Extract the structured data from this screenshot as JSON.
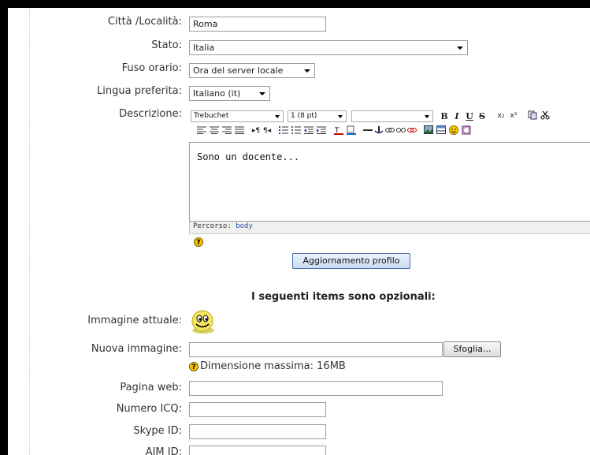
{
  "form": {
    "city_label": "Città /Località:",
    "city_value": "Roma",
    "country_label": "Stato:",
    "country_value": "Italia",
    "timezone_label": "Fuso orario:",
    "timezone_value": "Ora del server locale",
    "language_label": "Lingua preferita:",
    "language_value": "Italiano (it)",
    "description_label": "Descrizione:",
    "editor": {
      "font_value": "Trebuchet",
      "size_value": "1 (8 pt)",
      "format_value": "",
      "content": "Sono un docente...",
      "path_label": "Percorso:",
      "path_value": "body"
    },
    "update_button": "Aggiornamento profilo",
    "optional_heading": "I seguenti items sono opzionali:",
    "current_image_label": "Immagine attuale:",
    "new_image_label": "Nuova immagine:",
    "browse_button": "Sfoglia...",
    "max_size_text": "Dimensione massima: 16MB",
    "webpage_label": "Pagina web:",
    "icq_label": "Numero ICQ:",
    "skype_label": "Skype ID:",
    "aim_label": "AIM ID:"
  },
  "toolbar": {
    "bold": "B",
    "italic": "I",
    "underline": "U",
    "strike": "S",
    "sub": "x₂",
    "sup": "x²"
  },
  "icons": [
    "help-icon",
    "smiley-avatar-icon",
    "copy-icon",
    "cut-icon",
    "align-left-icon",
    "align-center-icon",
    "align-right-icon",
    "justify-icon",
    "ltr-icon",
    "rtl-icon",
    "ordered-list-icon",
    "unordered-list-icon",
    "outdent-icon",
    "indent-icon",
    "text-color-icon",
    "bg-color-icon",
    "hr-icon",
    "anchor-icon",
    "link-icon",
    "unlink-icon",
    "nolink-icon",
    "image-icon",
    "table-icon",
    "smiley-icon",
    "spellcheck-icon"
  ]
}
